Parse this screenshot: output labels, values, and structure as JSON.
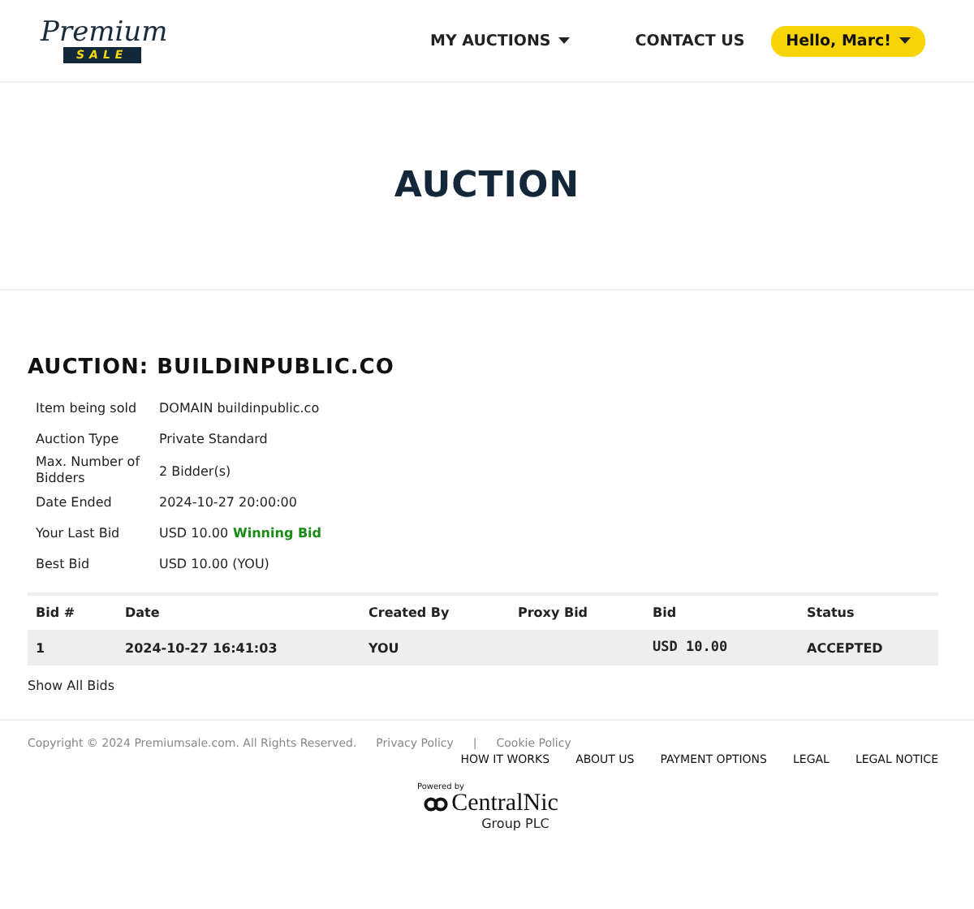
{
  "logo": {
    "script": "Premium",
    "banner": "SALE"
  },
  "nav": [
    {
      "label": "MY AUCTIONS",
      "dropdown": true
    },
    {
      "label": "CONTACT US",
      "dropdown": false
    }
  ],
  "user_menu": {
    "label": "Hello, Marc!"
  },
  "hero": {
    "title": "AUCTION"
  },
  "auction": {
    "heading": "AUCTION: BUILDINPUBLIC.CO",
    "details": [
      {
        "label": "Item being sold",
        "value": "DOMAIN buildinpublic.co"
      },
      {
        "label": "Auction Type",
        "value": "Private Standard"
      },
      {
        "label": "Max. Number of Bidders",
        "value": "2 Bidder(s)"
      },
      {
        "label": "Date Ended",
        "value": "2024-10-27 20:00:00"
      },
      {
        "label": "Your Last Bid",
        "value": "USD 10.00",
        "badge": "Winning Bid"
      },
      {
        "label": "Best Bid",
        "value": "USD 10.00 (YOU)"
      }
    ]
  },
  "bids_table": {
    "columns": [
      "Bid #",
      "Date",
      "Created By",
      "Proxy Bid",
      "Bid",
      "Status"
    ],
    "rows": [
      [
        "1",
        "2024-10-27 16:41:03",
        "YOU",
        "",
        "USD 10.00",
        "ACCEPTED"
      ]
    ]
  },
  "show_all": "Show All Bids",
  "footer": {
    "copyright": "Copyright © 2024 Premiumsale.com. All Rights Reserved.",
    "legal_links": [
      "Privacy Policy",
      "Cookie Policy"
    ],
    "separator": "|",
    "links": [
      "HOW IT WORKS",
      "ABOUT US",
      "PAYMENT OPTIONS",
      "LEGAL",
      "LEGAL NOTICE"
    ],
    "powered_by": "Powered by",
    "brand": "CentralNic",
    "brand_sub": "Group PLC"
  }
}
